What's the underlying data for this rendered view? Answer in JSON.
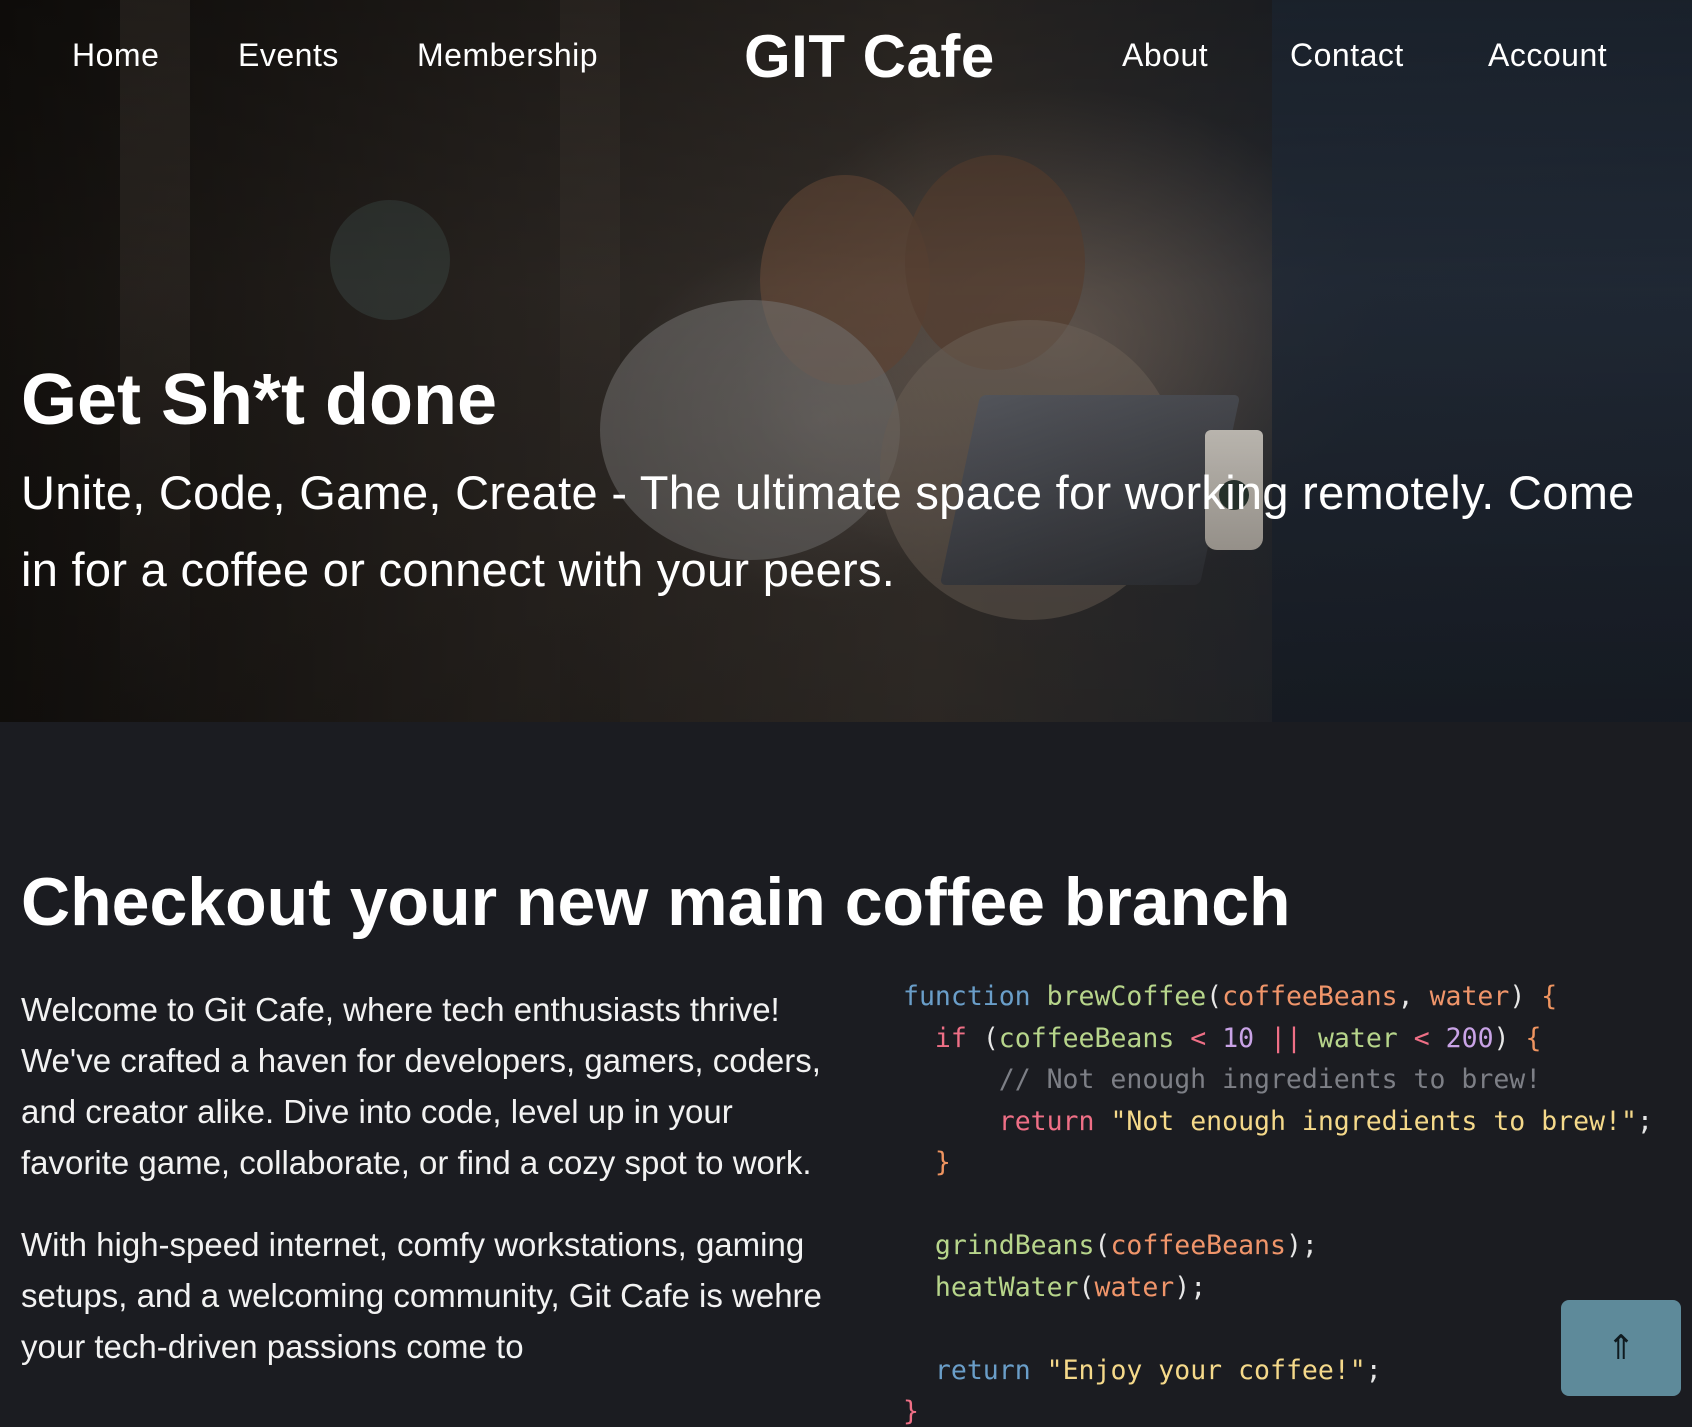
{
  "nav": {
    "brand": "GIT Cafe",
    "left": [
      "Home",
      "Events",
      "Membership"
    ],
    "right": [
      "About",
      "Contact",
      "Account"
    ]
  },
  "hero": {
    "title": "Get Sh*t done",
    "subtitle": "Unite, Code, Game, Create - The ultimate space for working remotely. Come in for a coffee or connect with your peers."
  },
  "section": {
    "title": "Checkout your new main coffee branch",
    "paragraphs": [
      "Welcome to Git Cafe, where tech enthusiasts thrive! We've crafted a haven for developers, gamers, coders, and creator alike. Dive into code, level up in your favorite game, collaborate, or find a cozy spot to work.",
      "With high-speed internet, comfy workstations, gaming setups, and a welcoming community, Git Cafe is wehre your tech-driven passions come to"
    ]
  },
  "code": {
    "lines": [
      "function brewCoffee(coffeeBeans, water) {",
      "  if (coffeeBeans < 10 || water < 200) {",
      "      // Not enough ingredients to brew!",
      "      return \"Not enough ingredients to brew!\";",
      "  }",
      "",
      "  grindBeans(coffeeBeans);",
      "  heatWater(water);",
      "",
      "  return \"Enjoy your coffee!\";",
      "}"
    ]
  },
  "back_to_top": {
    "icon": "arrow-up-icon",
    "glyph": "⇑"
  },
  "colors": {
    "page_background": "#1b1c21",
    "back_to_top_button": "#5e8a9a",
    "code_keyword": "#6a9ec9",
    "code_keyword_alt": "#ef6f86",
    "code_function": "#b7d58b",
    "code_parameter": "#f0956a",
    "code_number": "#c9a3e6",
    "code_string": "#f5d98a",
    "code_comment": "#7d7f86"
  }
}
